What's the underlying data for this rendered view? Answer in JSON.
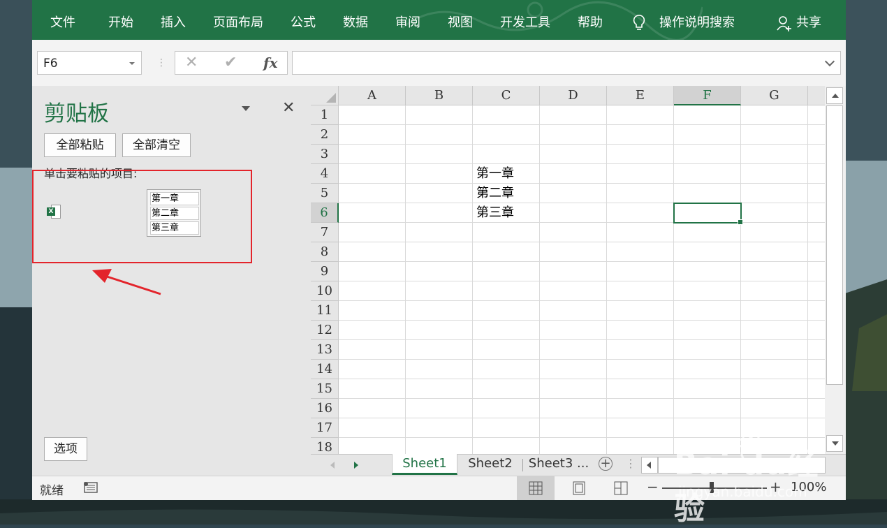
{
  "ribbon": {
    "tabs": [
      "文件",
      "开始",
      "插入",
      "页面布局",
      "公式",
      "数据",
      "审阅",
      "视图",
      "开发工具",
      "帮助"
    ],
    "tell_me": "操作说明搜索",
    "share": "共享",
    "accent": "#217346"
  },
  "formula_bar": {
    "name_box": "F6",
    "cancel_glyph": "✕",
    "enter_glyph": "✔",
    "fx_label": "fx",
    "formula": ""
  },
  "clipboard": {
    "title": "剪贴板",
    "paste_all": "全部粘贴",
    "clear_all": "全部清空",
    "hint": "单击要粘贴的项目:",
    "items": [
      {
        "source_icon": "excel-icon",
        "preview": [
          "第一章",
          "第二章",
          "第三章"
        ]
      }
    ],
    "options": "选项",
    "highlight_color": "#e3242b"
  },
  "grid": {
    "columns": [
      "A",
      "B",
      "C",
      "D",
      "E",
      "F",
      "G"
    ],
    "rows": [
      "1",
      "2",
      "3",
      "4",
      "5",
      "6",
      "7",
      "8",
      "9",
      "10",
      "11",
      "12",
      "13",
      "14",
      "15",
      "16",
      "17",
      "18"
    ],
    "active_cell": "F6",
    "cells": [
      {
        "ref": "C4",
        "value": "第一章"
      },
      {
        "ref": "C5",
        "value": "第二章"
      },
      {
        "ref": "C6",
        "value": "第三章"
      }
    ]
  },
  "sheets": {
    "tabs": [
      "Sheet1",
      "Sheet2",
      "Sheet3 ..."
    ],
    "active": "Sheet1"
  },
  "status": {
    "mode": "就绪",
    "zoom": "100%",
    "zoom_minus": "−",
    "zoom_plus": "+"
  },
  "watermark": {
    "brand": "Bai du经验",
    "url": "jingyan.baidu.com"
  }
}
